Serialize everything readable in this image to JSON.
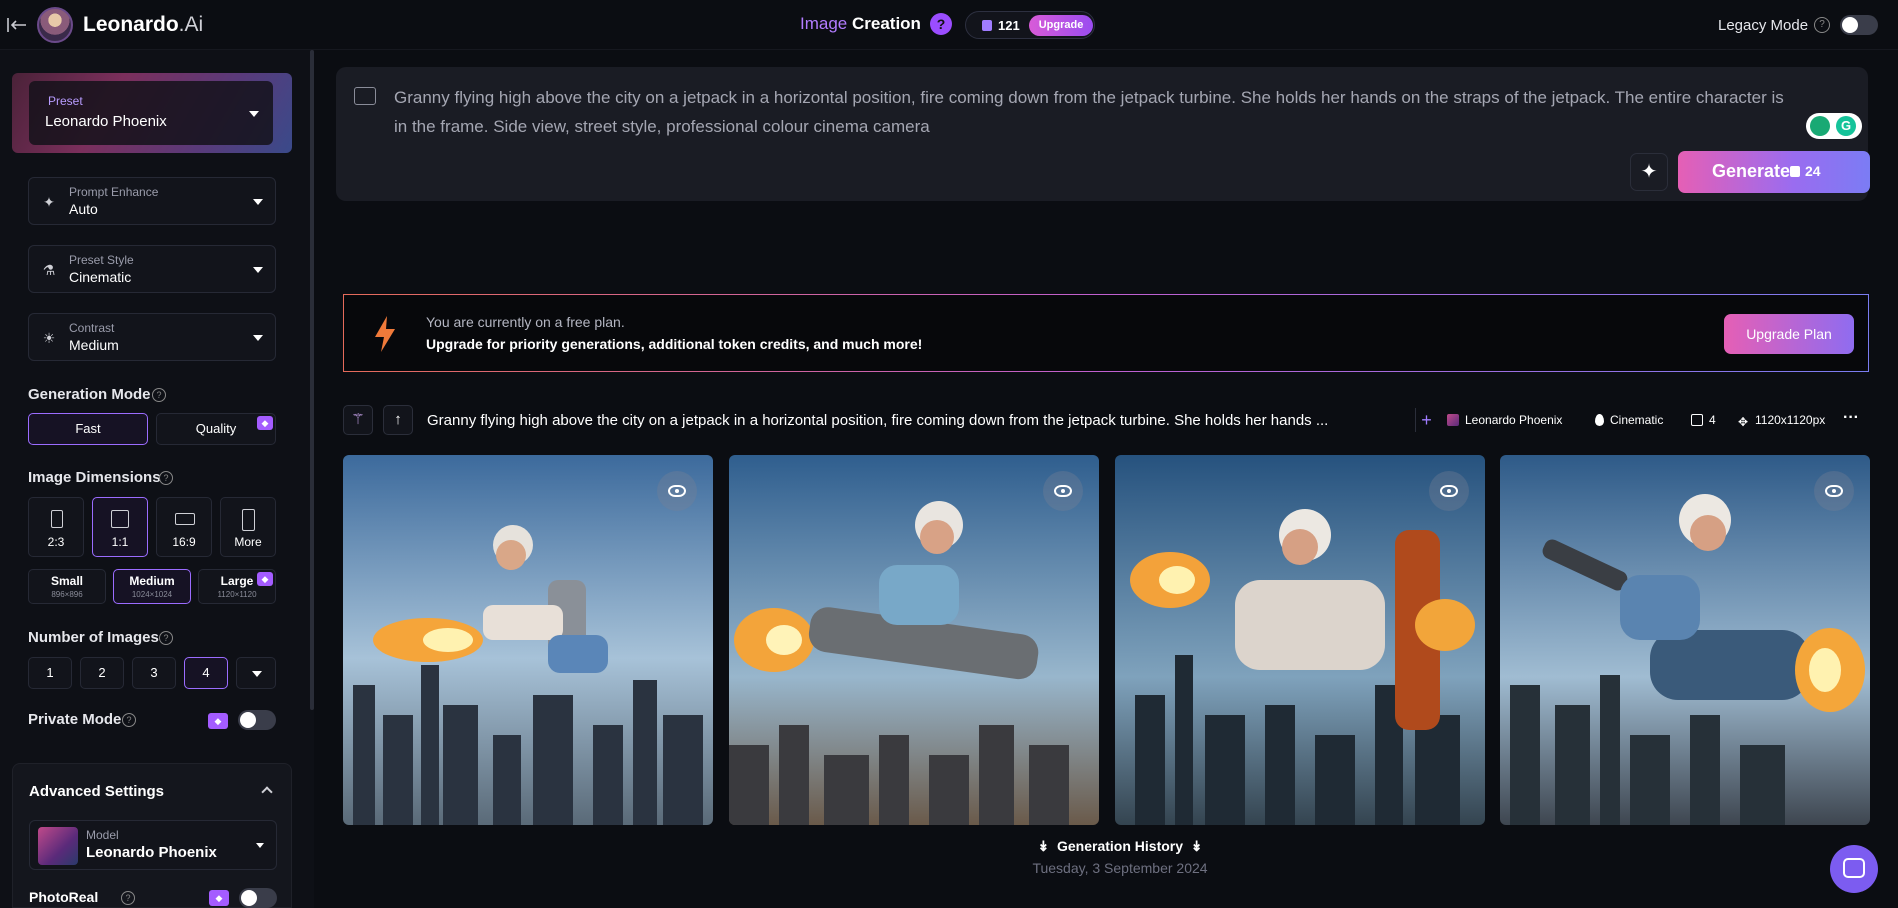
{
  "topbar": {
    "brand": "Leonardo",
    "brand_suffix": ".Ai",
    "title_part1": "Image",
    "title_part2": "Creation",
    "help_glyph": "?",
    "token_count": "121",
    "upgrade_label": "Upgrade",
    "legacy_mode_label": "Legacy Mode",
    "legacy_help": "?"
  },
  "sidebar": {
    "preset": {
      "label": "Preset",
      "value": "Leonardo Phoenix"
    },
    "prompt_enhance": {
      "label": "Prompt Enhance",
      "value": "Auto"
    },
    "preset_style": {
      "label": "Preset Style",
      "value": "Cinematic"
    },
    "contrast": {
      "label": "Contrast",
      "value": "Medium"
    },
    "generation_mode": {
      "label": "Generation Mode",
      "options": [
        "Fast",
        "Quality"
      ],
      "selected": "Fast"
    },
    "image_dimensions": {
      "label": "Image Dimensions",
      "ratios": [
        "2:3",
        "1:1",
        "16:9",
        "More"
      ],
      "selected_ratio": "1:1",
      "sizes": [
        {
          "name": "Small",
          "px": "896×896"
        },
        {
          "name": "Medium",
          "px": "1024×1024"
        },
        {
          "name": "Large",
          "px": "1120×1120"
        }
      ],
      "selected_size": "Medium"
    },
    "number_of_images": {
      "label": "Number of Images",
      "options": [
        "1",
        "2",
        "3",
        "4"
      ],
      "selected": "4"
    },
    "private_mode_label": "Private Mode",
    "advanced": {
      "title": "Advanced Settings",
      "model_label": "Model",
      "model_value": "Leonardo Phoenix",
      "photoreal_label": "PhotoReal"
    }
  },
  "prompt": {
    "text": "Granny flying high above the city on a jetpack in a horizontal position, fire coming down from the jetpack turbine. She holds her hands on the straps of the jetpack. The entire character is in the frame. Side view, street style, professional colour cinema camera",
    "generate_label": "Generate",
    "generate_cost": "24"
  },
  "banner": {
    "line1": "You are currently on a free plan.",
    "line2": "Upgrade for priority generations, additional token credits, and much more!",
    "button": "Upgrade Plan"
  },
  "generation": {
    "prompt_truncated": "Granny flying high above the city on a jetpack in a horizontal position, fire coming down from the jetpack turbine. She holds her hands ...",
    "model": "Leonardo Phoenix",
    "style": "Cinematic",
    "count": "4",
    "dimensions": "1120x1120px",
    "more": "···",
    "plus": "+"
  },
  "history": {
    "title": "Generation History",
    "date": "Tuesday, 3 September 2024"
  },
  "colors": {
    "background": "#0b0d12",
    "accent_purple": "#9b6cff",
    "gradient_pink": "#e55fb5",
    "gradient_violet": "#7b7cf4"
  },
  "icons": [
    "back-arrow-icon",
    "image-icon",
    "sparkle-icon",
    "bolt-icon",
    "eye-icon",
    "chat-icon",
    "gem-icon"
  ]
}
